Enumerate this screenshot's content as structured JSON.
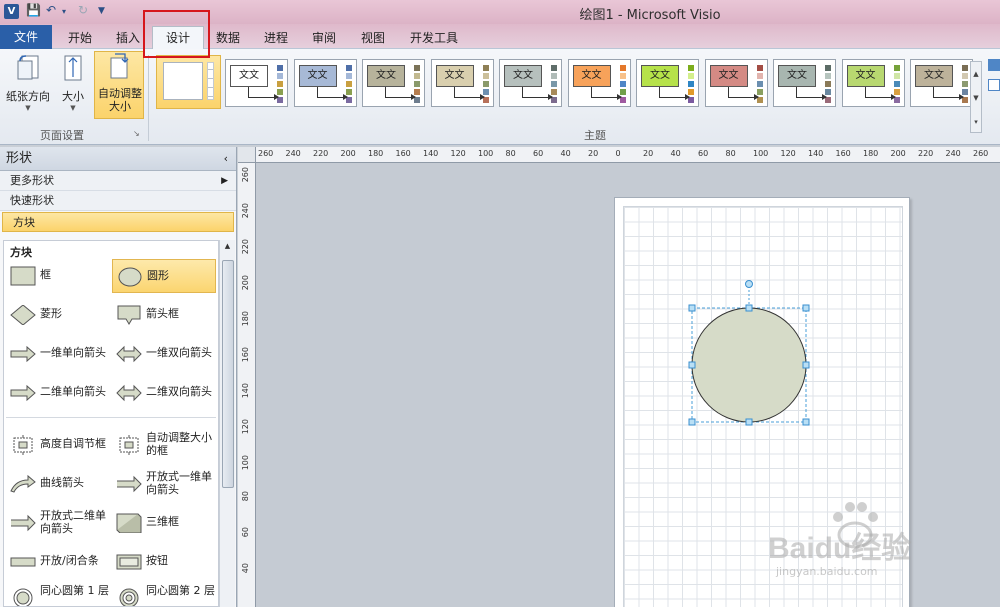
{
  "window": {
    "title": "绘图1 - Microsoft Visio",
    "app_icon": "V"
  },
  "tabs": [
    {
      "label": "文件"
    },
    {
      "label": "开始"
    },
    {
      "label": "插入"
    },
    {
      "label": "设计"
    },
    {
      "label": "数据"
    },
    {
      "label": "进程"
    },
    {
      "label": "审阅"
    },
    {
      "label": "视图"
    },
    {
      "label": "开发工具"
    }
  ],
  "active_tab": "设计",
  "ribbon": {
    "page_setup": {
      "label": "页面设置",
      "orientation": "纸张方向",
      "size": "大小",
      "auto_size": "自动调整大小"
    },
    "themes": {
      "label": "主题",
      "sample_text": "文文",
      "items": [
        {
          "fill": "#ffffff",
          "bars": [
            "#4f6fa8",
            "#a4b8d8",
            "#c9a040",
            "#8aa050",
            "#7a6aa0"
          ]
        },
        {
          "fill": "#a7b9d6",
          "bars": [
            "#4f6fa8",
            "#a4b8d8",
            "#c9a040",
            "#8aa050",
            "#7a6aa0"
          ]
        },
        {
          "fill": "#b7b39b",
          "bars": [
            "#7b7358",
            "#c2b98f",
            "#8a9a6b",
            "#b57d4f",
            "#6e7d8e"
          ]
        },
        {
          "fill": "#d9cfae",
          "bars": [
            "#8e7f55",
            "#cbbf9a",
            "#8a9a6b",
            "#6c8fb0",
            "#b77059"
          ]
        },
        {
          "fill": "#b6c0bd",
          "bars": [
            "#5f6e6a",
            "#b0bcb8",
            "#7a98a8",
            "#a88a5a",
            "#7d6b8e"
          ]
        },
        {
          "fill": "#f7a25a",
          "bars": [
            "#e4782a",
            "#f8c18a",
            "#4f86c6",
            "#72a04a",
            "#a05aa0"
          ]
        },
        {
          "fill": "#b6e24a",
          "bars": [
            "#7cad1c",
            "#d3ef8c",
            "#2f86c4",
            "#e09a2a",
            "#7a5aa0"
          ]
        },
        {
          "fill": "#d48a84",
          "bars": [
            "#a34d45",
            "#e2b4ae",
            "#6b8fb0",
            "#8aa060",
            "#b09050"
          ]
        },
        {
          "fill": "#a8b6b0",
          "bars": [
            "#5c6c66",
            "#b6c4be",
            "#8a7a58",
            "#6a88a0",
            "#9a6a78"
          ]
        },
        {
          "fill": "#b8d870",
          "bars": [
            "#76a23a",
            "#d0e6a6",
            "#4a8ab8",
            "#d9a040",
            "#8a6aa0"
          ]
        },
        {
          "fill": "#bdb29a",
          "bars": [
            "#7a6e54",
            "#d2c8b0",
            "#8c9a70",
            "#6c84a0",
            "#a8784e"
          ]
        }
      ]
    }
  },
  "shapes_panel": {
    "title": "形状",
    "more_shapes": "更多形状",
    "quick_shapes": "快速形状",
    "selected_stencil": "方块",
    "stencil_title": "方块",
    "items": [
      {
        "label": "框",
        "icon": "box-icon"
      },
      {
        "label": "圆形",
        "icon": "circle-icon"
      },
      {
        "label": "菱形",
        "icon": "diamond-icon"
      },
      {
        "label": "箭头框",
        "icon": "arrow-box-icon"
      },
      {
        "label": "一维单向箭头",
        "icon": "arrow-right-icon"
      },
      {
        "label": "一维双向箭头",
        "icon": "arrow-double-icon"
      },
      {
        "label": "二维单向箭头",
        "icon": "arrow-right-icon"
      },
      {
        "label": "二维双向箭头",
        "icon": "arrow-double-icon"
      },
      {
        "label": "高度自调节框",
        "icon": "auto-height-box-icon"
      },
      {
        "label": "自动调整大小的框",
        "icon": "auto-size-box-icon"
      },
      {
        "label": "曲线箭头",
        "icon": "curved-arrow-icon"
      },
      {
        "label": "开放式一维单向箭头",
        "icon": "open-arrow-icon"
      },
      {
        "label": "开放式二维单向箭头",
        "icon": "open-arrow-icon"
      },
      {
        "label": "三维框",
        "icon": "3d-box-icon"
      },
      {
        "label": "开放/闭合条",
        "icon": "bar-icon"
      },
      {
        "label": "按钮",
        "icon": "button-icon"
      },
      {
        "label": "同心圆第 1 层",
        "icon": "concentric-icon"
      },
      {
        "label": "同心圆第 2 层",
        "icon": "concentric-icon"
      }
    ]
  },
  "rulers": {
    "h_ticks": [
      "260",
      "240",
      "220",
      "200",
      "180",
      "160",
      "140",
      "120",
      "100",
      "80",
      "60",
      "40",
      "20",
      "0",
      "20",
      "40",
      "60",
      "80",
      "100",
      "120",
      "140",
      "160",
      "180",
      "200",
      "220",
      "240",
      "260"
    ],
    "v_ticks": [
      "260",
      "240",
      "220",
      "200",
      "180",
      "160",
      "140",
      "120",
      "100",
      "80",
      "60",
      "40"
    ]
  },
  "canvas": {
    "shape_fill": "#d6dbc8"
  },
  "watermark": {
    "line1": "Baidu经验",
    "line2": "jingyan.baidu.com"
  }
}
